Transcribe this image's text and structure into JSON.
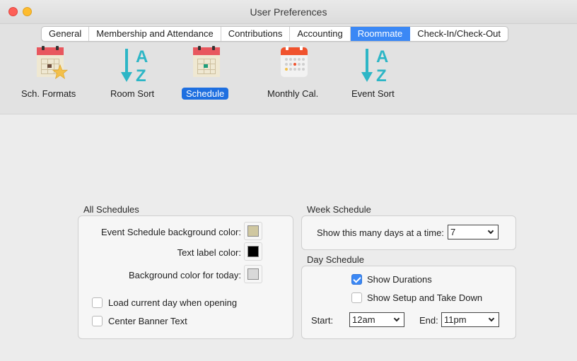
{
  "window": {
    "title": "User Preferences"
  },
  "tabs": [
    {
      "label": "General"
    },
    {
      "label": "Membership and Attendance"
    },
    {
      "label": "Contributions"
    },
    {
      "label": "Accounting"
    },
    {
      "label": "Roommate",
      "active": true
    },
    {
      "label": "Check-In/Check-Out"
    }
  ],
  "toolbar_icons": [
    {
      "label": "Sch. Formats",
      "icon": "calendar-star-icon"
    },
    {
      "label": "Room Sort",
      "icon": "sort-az-icon"
    },
    {
      "label": "Schedule",
      "icon": "calendar-icon",
      "selected": true
    },
    {
      "label": "Monthly Cal.",
      "icon": "monthly-calendar-icon"
    },
    {
      "label": "Event Sort",
      "icon": "sort-az-icon"
    }
  ],
  "all_schedules": {
    "title": "All Schedules",
    "event_bg_label": "Event Schedule background color:",
    "event_bg_color": "#cfc7a0",
    "text_label_label": "Text label color:",
    "text_label_color": "#000000",
    "today_bg_label": "Background color for today:",
    "today_bg_color": "#d9d9d9",
    "load_current_day_label": "Load current day when opening",
    "load_current_day_checked": false,
    "center_banner_label": "Center Banner Text",
    "center_banner_checked": false
  },
  "week_schedule": {
    "title": "Week Schedule",
    "days_label": "Show this many days at a time:",
    "days_value": "7"
  },
  "day_schedule": {
    "title": "Day Schedule",
    "show_durations_label": "Show Durations",
    "show_durations_checked": true,
    "show_setup_label": "Show Setup and Take Down",
    "show_setup_checked": false,
    "start_label": "Start:",
    "start_value": "12am",
    "end_label": "End:",
    "end_value": "11pm"
  },
  "colors": {
    "accent": "#3b88f5",
    "selected_label": "#1e6fe0"
  }
}
